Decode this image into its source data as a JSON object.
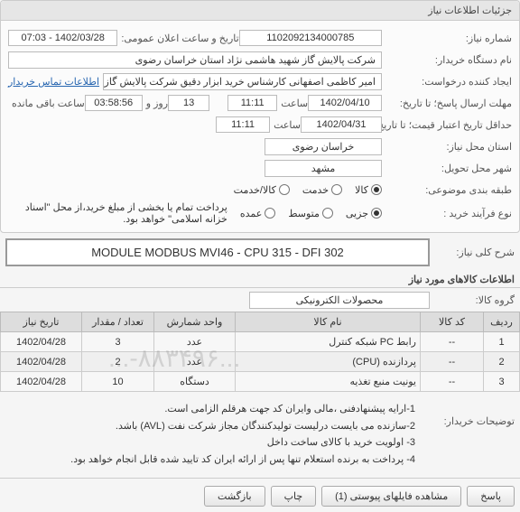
{
  "panel": {
    "title": "جزئیات اطلاعات نیاز"
  },
  "fields": {
    "need_number_label": "شماره نیاز:",
    "need_number": "1102092134000785",
    "announce_label": "تاریخ و ساعت اعلان عمومی:",
    "announce_value": "1402/03/28 - 07:03",
    "buyer_label": "نام دستگاه خریدار:",
    "buyer_value": "شرکت پالایش گاز شهید هاشمی نژاد   استان خراسان رضوی",
    "creator_label": "ایجاد کننده درخواست:",
    "creator_value": "امیر کاظمی اصفهانی کارشناس خرید ابزار دقیق شرکت پالایش گاز شهید هاشـ",
    "contact_link": "اطلاعات تماس خریدار",
    "deadline_label": "مهلت ارسال پاسخ؛ تا تاریخ:",
    "deadline_date": "1402/04/10",
    "time_label": "ساعت",
    "deadline_time": "11:11",
    "days_val": "13",
    "days_text": "روز و",
    "countdown": "03:58:56",
    "remain_text": "ساعت باقی مانده",
    "validity_label": "حداقل تاریخ اعتبار قیمت؛ تا تاریخ:",
    "validity_date": "1402/04/31",
    "validity_time": "11:11",
    "need_place_label": "استان محل نیاز:",
    "need_place": "خراسان رضوی",
    "delivery_city_label": "شهر محل تحویل:",
    "delivery_city": "مشهد",
    "budget_label": "طبقه بندی موضوعی:",
    "budget_opts": {
      "kala": "کالا",
      "khadamat": "خدمت",
      "kala_khadamat": "کالا/خدمت"
    },
    "buy_type_label": "نوع فرآیند خرید :",
    "buy_opts": {
      "jozei": "جزیی",
      "motevaset": "متوسط",
      "omde": "عمده"
    },
    "pay_note": "پرداخت تمام یا بخشی از مبلغ خرید،از محل \"اسناد خزانه اسلامی\" خواهد بود.",
    "subject_label": "شرح کلی نیاز:",
    "subject_value": "MODULE MODBUS MVI46 - CPU 315 - DFI 302",
    "items_info_title": "اطلاعات کالاهای مورد نیاز",
    "group_label": "گروه کالا:",
    "group_value": "محصولات الکترونیکی"
  },
  "table": {
    "headers": {
      "row": "ردیف",
      "code": "کد کالا",
      "name": "نام کالا",
      "unit": "واحد شمارش",
      "qty": "تعداد / مقدار",
      "date": "تاریخ نیاز"
    },
    "rows": [
      {
        "row": "1",
        "code": "--",
        "name": "رابط PC شبکه کنترل",
        "unit": "عدد",
        "qty": "3",
        "date": "1402/04/28"
      },
      {
        "row": "2",
        "code": "--",
        "name": "پردازنده (CPU)",
        "unit": "عدد",
        "qty": "2",
        "date": "1402/04/28"
      },
      {
        "row": "3",
        "code": "--",
        "name": "یونیت منبع تغذیه",
        "unit": "دستگاه",
        "qty": "10",
        "date": "1402/04/28"
      }
    ]
  },
  "buyer_notes_label": "توضیحات خریدار:",
  "buyer_notes": [
    "1-ارایه پیشنهادفنی ،مالی وایران کد جهت هرقلم الزامی است.",
    "2-سازنده می بایست درلیست تولیدکنندگان مجاز شرکت نفت (AVL)  باشد.",
    "3- اولویت خرید با کالای ساخت داخل",
    "4- پرداخت به برنده استعلام تنها پس از ارائه ایران کد تایید شده قابل انجام خواهد بود."
  ],
  "buttons": {
    "reply": "پاسخ",
    "attachments": "مشاهده فایلهای پیوستی  (1)",
    "print": "چاپ",
    "back": "بازگشت"
  },
  "watermark": "...-۸۸۳۴۹۶..."
}
